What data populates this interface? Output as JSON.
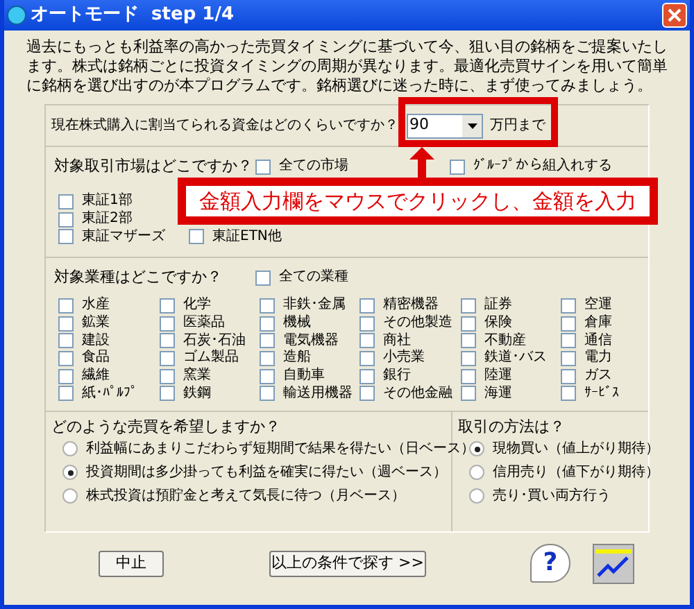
{
  "window": {
    "title": "オートモード  step 1/4"
  },
  "intro": "過去にもっとも利益率の高かった売買タイミングに基づいて今、狙い目の銘柄をご提案いたします。株式は銘柄ごとに投資タイミングの周期が異なります。最適化売買サインを用いて簡単に銘柄を選び出すのが本プログラムです。銘柄選びに迷った時に、まず使ってみましょう。",
  "budget": {
    "label": "現在株式購入に割当てられる資金はどのくらいですか？",
    "value": "90",
    "unit": "万円まで"
  },
  "markets": {
    "label": "対象取引市場はどこですか？",
    "all": {
      "label": "全ての市場",
      "checked": false
    },
    "group": {
      "label": "ｸﾞﾙｰﾌﾟから組入れする",
      "checked": false
    },
    "column_1": [
      {
        "label": "東証1部",
        "checked": false
      },
      {
        "label": "東証2部",
        "checked": false
      },
      {
        "label": "東証マザーズ",
        "checked": false
      }
    ],
    "column_2": [
      {
        "label": "東証ETN他",
        "checked": false
      }
    ]
  },
  "industries": {
    "label": "対象業種はどこですか？",
    "all": {
      "label": "全ての業種",
      "checked": false
    },
    "items": [
      {
        "label": "水産",
        "checked": false
      },
      {
        "label": "化学",
        "checked": false
      },
      {
        "label": "非鉄･金属",
        "checked": false
      },
      {
        "label": "精密機器",
        "checked": false
      },
      {
        "label": "証券",
        "checked": false
      },
      {
        "label": "空運",
        "checked": false
      },
      {
        "label": "鉱業",
        "checked": false
      },
      {
        "label": "医薬品",
        "checked": false
      },
      {
        "label": "機械",
        "checked": false
      },
      {
        "label": "その他製造",
        "checked": false
      },
      {
        "label": "保険",
        "checked": false
      },
      {
        "label": "倉庫",
        "checked": false
      },
      {
        "label": "建設",
        "checked": false
      },
      {
        "label": "石炭･石油",
        "checked": false
      },
      {
        "label": "電気機器",
        "checked": false
      },
      {
        "label": "商社",
        "checked": false
      },
      {
        "label": "不動産",
        "checked": false
      },
      {
        "label": "通信",
        "checked": false
      },
      {
        "label": "食品",
        "checked": false
      },
      {
        "label": "ゴム製品",
        "checked": false
      },
      {
        "label": "造船",
        "checked": false
      },
      {
        "label": "小売業",
        "checked": false
      },
      {
        "label": "鉄道･バス",
        "checked": false
      },
      {
        "label": "電力",
        "checked": false
      },
      {
        "label": "繊維",
        "checked": false
      },
      {
        "label": "窯業",
        "checked": false
      },
      {
        "label": "自動車",
        "checked": false
      },
      {
        "label": "銀行",
        "checked": false
      },
      {
        "label": "陸運",
        "checked": false
      },
      {
        "label": "ガス",
        "checked": false
      },
      {
        "label": "紙･ﾊﾟﾙﾌﾟ",
        "checked": false
      },
      {
        "label": "鉄鋼",
        "checked": false
      },
      {
        "label": "輸送用機器",
        "checked": false
      },
      {
        "label": "その他金融",
        "checked": false
      },
      {
        "label": "海運",
        "checked": false
      },
      {
        "label": "ｻｰﾋﾞｽ",
        "checked": false
      }
    ]
  },
  "style": {
    "label": "どのような売買を希望しますか？",
    "options": [
      {
        "label": "利益幅にあまりこだわらず短期間で結果を得たい（日ベース）",
        "selected": false
      },
      {
        "label": "投資期間は多少掛っても利益を確実に得たい（週ベース）",
        "selected": true
      },
      {
        "label": "株式投資は預貯金と考えて気長に待つ（月ベース）",
        "selected": false
      }
    ]
  },
  "method": {
    "label": "取引の方法は？",
    "options": [
      {
        "label": "現物買い（値上がり期待）",
        "selected": true
      },
      {
        "label": "信用売り（値下がり期待）",
        "selected": false
      },
      {
        "label": "売り･買い両方行う",
        "selected": false
      }
    ]
  },
  "buttons": {
    "cancel": "中止",
    "search": "以上の条件で探す >>",
    "help": "?"
  },
  "callout": {
    "text": "金額入力欄をマウスでクリックし、金額を入力"
  }
}
